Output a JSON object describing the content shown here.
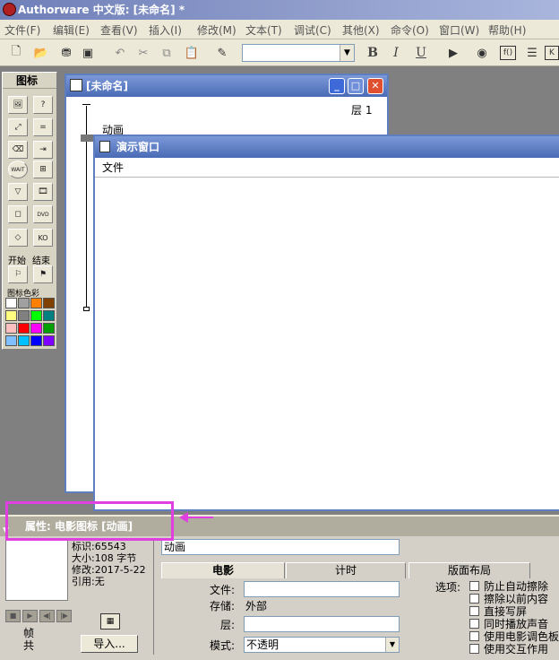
{
  "app": {
    "title": "Authorware 中文版: [未命名] *"
  },
  "menu": [
    "文件(F)",
    "编辑(E)",
    "查看(V)",
    "插入(I)",
    "修改(M)",
    "文本(T)",
    "调试(C)",
    "其他(X)",
    "命令(O)",
    "窗口(W)",
    "帮助(H)"
  ],
  "toolbar": {
    "font_combo": "",
    "bold": "B",
    "italic": "I",
    "underline": "U"
  },
  "palette": {
    "title": "图标",
    "start_label": "开始",
    "end_label": "结束",
    "colors_label": "图标色彩",
    "swatches": [
      "#ffffff",
      "#a0a0a0",
      "#ff8000",
      "#804000",
      "#ffff80",
      "#808080",
      "#00ff00",
      "#008080",
      "#ffc0c0",
      "#ff0000",
      "#ff00ff",
      "#00a000",
      "#80c0ff",
      "#00c0ff",
      "#0000ff",
      "#8000ff"
    ],
    "icons": {
      "wait": "WAIT",
      "dvd": "DVD",
      "ko": "KO"
    }
  },
  "flow_window": {
    "title": "[未命名]",
    "layer_label": "层 1",
    "icon_label": "动画"
  },
  "present_window": {
    "title": "演示窗口",
    "menu_file": "文件"
  },
  "props": {
    "title": "属性: 电影图标 [动画]",
    "id_text": "标识:65543",
    "size_text": "大小:108 字节",
    "modified_text": "修改:2017-5-22",
    "ref_text": "引用:无",
    "frame_label": "帧",
    "total_label": "共",
    "import_button": "导入...",
    "name_value": "动画",
    "tabs": [
      "电影",
      "计时",
      "版面布局"
    ],
    "file_label": "文件:",
    "file_value": "",
    "storage_label": "存储:",
    "storage_value": "外部",
    "layer_label": "层:",
    "layer_value": "",
    "mode_label": "模式:",
    "mode_value": "不透明",
    "options_label": "选项:",
    "options": [
      "防止自动擦除",
      "擦除以前内容",
      "直接写屏",
      "同时播放声音",
      "使用电影调色板",
      "使用交互作用"
    ]
  }
}
